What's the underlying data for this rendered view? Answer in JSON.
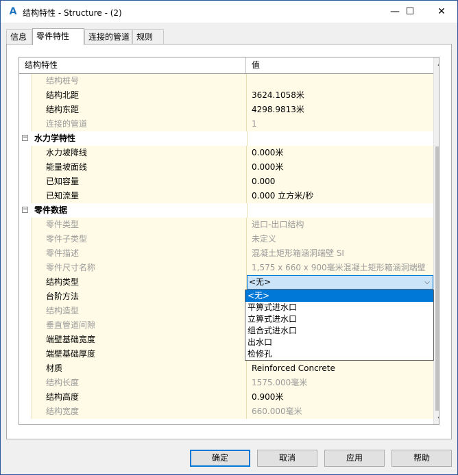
{
  "window": {
    "title": "结构特性 - Structure - (2)",
    "app_icon": "A",
    "buttons": {
      "minimize": "—",
      "maximize": "☐",
      "close": "✕"
    }
  },
  "tabs": [
    {
      "label": "信息"
    },
    {
      "label": "零件特性"
    },
    {
      "label": "连接的管道"
    },
    {
      "label": "规则"
    }
  ],
  "grid": {
    "header_name": "结构特性",
    "header_value": "值",
    "rows": [
      {
        "name": "结构桩号",
        "value": "",
        "kind": "ro"
      },
      {
        "name": "结构北距",
        "value": "3624.1058米",
        "kind": "rw"
      },
      {
        "name": "结构东距",
        "value": "4298.9813米",
        "kind": "rw"
      },
      {
        "name": "连接的管道",
        "value": "1",
        "kind": "ro"
      },
      {
        "name": "水力学特性",
        "value": "",
        "kind": "cat"
      },
      {
        "name": "水力坡降线",
        "value": "0.000米",
        "kind": "rw"
      },
      {
        "name": "能量坡面线",
        "value": "0.000米",
        "kind": "rw"
      },
      {
        "name": "已知容量",
        "value": "0.000",
        "kind": "rw"
      },
      {
        "name": "已知流量",
        "value": "0.000 立方米/秒",
        "kind": "rw"
      },
      {
        "name": "零件数据",
        "value": "",
        "kind": "cat"
      },
      {
        "name": "零件类型",
        "value": "进口-出口结构",
        "kind": "ro"
      },
      {
        "name": "零件子类型",
        "value": "未定义",
        "kind": "ro"
      },
      {
        "name": "零件描述",
        "value": "混凝土矩形箱涵洞端壁 SI",
        "kind": "ro"
      },
      {
        "name": "零件尺寸名称",
        "value": "1,575 x 660 x 900毫米混凝土矩形箱涵洞端壁",
        "kind": "ro"
      },
      {
        "name": "结构类型",
        "value": "<无>",
        "kind": "sel"
      },
      {
        "name": "台阶方法",
        "value": "",
        "kind": "rw"
      },
      {
        "name": "结构造型",
        "value": "",
        "kind": "ro"
      },
      {
        "name": "垂直管道间隙",
        "value": "",
        "kind": "ro"
      },
      {
        "name": "端壁基础宽度",
        "value": "",
        "kind": "rw"
      },
      {
        "name": "端壁基础厚度",
        "value": "",
        "kind": "rw"
      },
      {
        "name": "材质",
        "value": "Reinforced Concrete",
        "kind": "rw"
      },
      {
        "name": "结构长度",
        "value": "1575.000毫米",
        "kind": "ro"
      },
      {
        "name": "结构高度",
        "value": "0.900米",
        "kind": "rw"
      },
      {
        "name": "结构宽度",
        "value": "660.000毫米",
        "kind": "ro"
      }
    ]
  },
  "dropdown": {
    "options": [
      "<无>",
      "平箅式进水口",
      "立箅式进水口",
      "组合式进水口",
      "出水口",
      "检修孔"
    ],
    "selected_index": 0
  },
  "scrollbar": {
    "up_icon": "▲",
    "down_icon": "▼"
  },
  "buttons": {
    "ok": "确定",
    "cancel": "取消",
    "apply": "应用",
    "help": "帮助"
  }
}
